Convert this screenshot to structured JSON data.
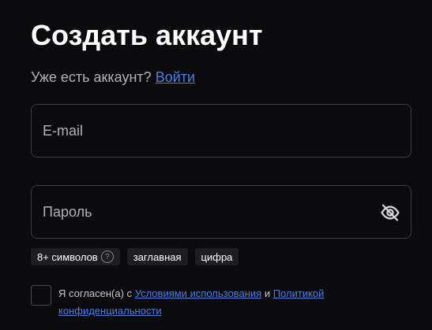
{
  "page": {
    "title": "Создать аккаунт"
  },
  "signin": {
    "prompt": "Уже есть аккаунт?",
    "link": "Войти"
  },
  "form": {
    "email": {
      "placeholder": "E-mail",
      "value": ""
    },
    "password": {
      "placeholder": "Пароль",
      "value": "",
      "toggle_icon": "eye-off-icon"
    }
  },
  "password_hints": [
    {
      "label": "8+ символов",
      "help_icon": "question-icon",
      "help_glyph": "?"
    },
    {
      "label": "заглавная"
    },
    {
      "label": "цифра"
    }
  ],
  "consent": {
    "checked": false,
    "prefix": "Я согласен(а) с",
    "terms_link": "Условиями использования",
    "conjunction": "и",
    "privacy_link_line1": "Политикой",
    "privacy_link_line2": "конфиденциальности"
  },
  "colors": {
    "background": "#0b0a0d",
    "link": "#4a7ee0",
    "border": "#3e3d42",
    "chip": "#1e1d22"
  }
}
